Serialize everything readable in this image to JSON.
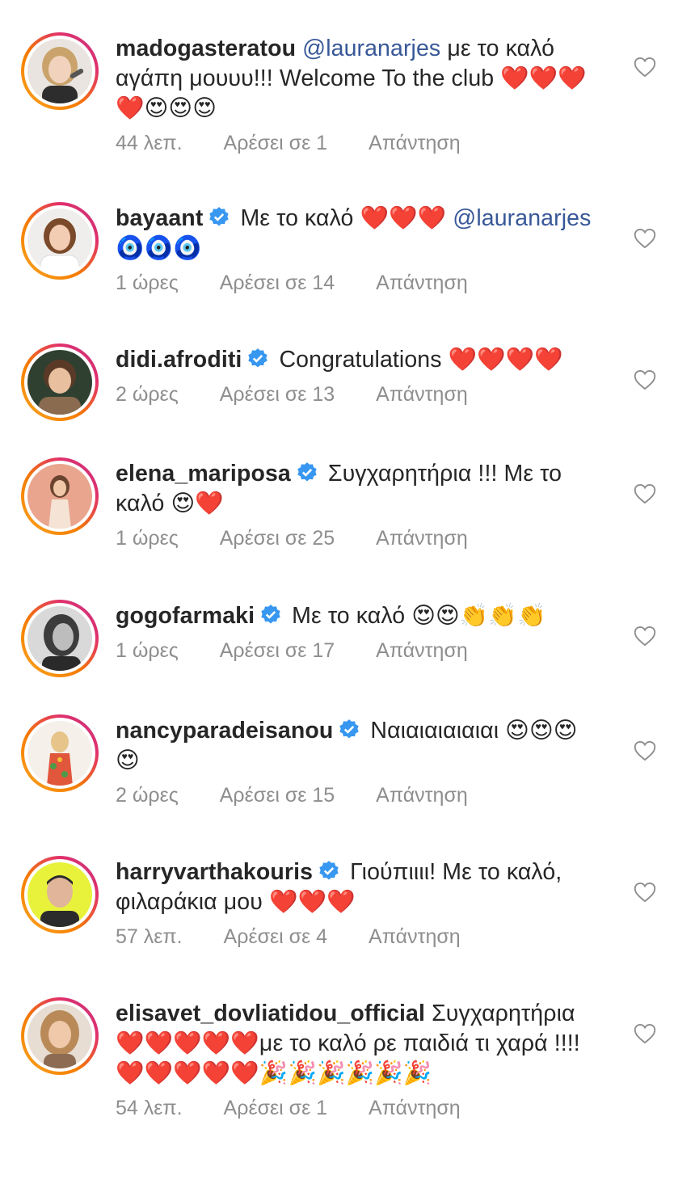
{
  "colors": {
    "text": "#262626",
    "meta": "#8e8e8e",
    "mention": "#385898",
    "verified": "#3897f0",
    "ring": [
      "#f9a825",
      "#e1306c",
      "#c13584"
    ]
  },
  "icons": {
    "verified": "verified-badge-icon",
    "like": "heart-outline-icon"
  },
  "comments": [
    {
      "username": "madogasteratou",
      "verified": false,
      "mention": "@lauranarjes",
      "text_after_mention": " με το καλό αγάπη μουυυ!!! Welcome To the club ❤️❤️❤️❤️😍😍😍",
      "time": "44 λεπ.",
      "likes": "Αρέσει σε 1",
      "reply": "Απάντηση"
    },
    {
      "username": "bayaant",
      "verified": true,
      "text": "Με το καλό ❤️❤️❤️",
      "mention": "@lauranarjes",
      "text_after_mention": " 🧿🧿🧿",
      "time": "1 ώρες",
      "likes": "Αρέσει σε 14",
      "reply": "Απάντηση"
    },
    {
      "username": "didi.afroditi",
      "verified": true,
      "text": "Congratulations ❤️❤️❤️❤️",
      "time": "2 ώρες",
      "likes": "Αρέσει σε 13",
      "reply": "Απάντηση"
    },
    {
      "username": "elena_mariposa",
      "verified": true,
      "text": "Συγχαρητήρια !!! Με το καλό 😍❤️",
      "time": "1 ώρες",
      "likes": "Αρέσει σε 25",
      "reply": "Απάντηση"
    },
    {
      "username": "gogofarmaki",
      "verified": true,
      "text": "Με το καλό 😍😍👏👏👏",
      "time": "1 ώρες",
      "likes": "Αρέσει σε 17",
      "reply": "Απάντηση"
    },
    {
      "username": "nancyparadeisanou",
      "verified": true,
      "text": "Ναιαιαιαιαιαι 😍😍😍😍",
      "time": "2 ώρες",
      "likes": "Αρέσει σε 15",
      "reply": "Απάντηση"
    },
    {
      "username": "harryvarthakouris",
      "verified": true,
      "text": "Γιούπιιιι! Με το καλό, φιλαράκια μου ❤️❤️❤️",
      "time": "57 λεπ.",
      "likes": "Αρέσει σε 4",
      "reply": "Απάντηση"
    },
    {
      "username": "elisavet_dovliatidou_official",
      "verified": false,
      "text": "Συγχαρητήρια ❤️❤️❤️❤️❤️με το καλό ρε παιδιά τι χαρά !!!!❤️❤️❤️❤️❤️🎉🎉🎉🎉🎉🎉",
      "time": "54 λεπ.",
      "likes": "Αρέσει σε 1",
      "reply": "Απάντηση"
    }
  ]
}
